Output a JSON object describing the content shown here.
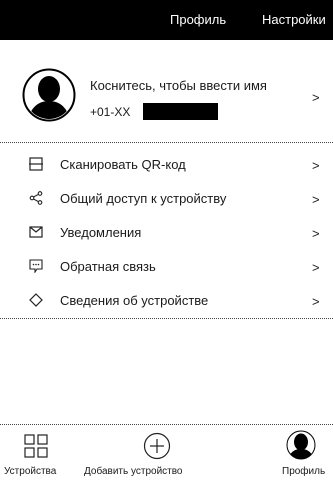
{
  "header": {
    "title": "Профиль",
    "settings_label": "Настройки"
  },
  "profile": {
    "name_prompt": "Коснитесь, чтобы ввести имя",
    "phone": "+01-XX",
    "chevron": ">"
  },
  "menu": {
    "items": [
      {
        "icon": "scan-icon",
        "label": "Сканировать QR-код",
        "chevron": ">"
      },
      {
        "icon": "share-icon",
        "label": "Общий доступ к устройству",
        "chevron": ">"
      },
      {
        "icon": "mail-icon",
        "label": "Уведомления",
        "chevron": ">"
      },
      {
        "icon": "feedback-icon",
        "label": "Обратная связь",
        "chevron": ">"
      },
      {
        "icon": "info-diamond-icon",
        "label": "Сведения об устройстве",
        "chevron": ">"
      }
    ]
  },
  "tabbar": {
    "devices_label": "Устройства",
    "add_device_label": "Добавить устройство",
    "profile_label": "Профиль",
    "active_tab": "Профиль"
  },
  "colors": {
    "header_bg": "#000000",
    "header_text": "#ffffff",
    "text": "#1a1a1a"
  }
}
